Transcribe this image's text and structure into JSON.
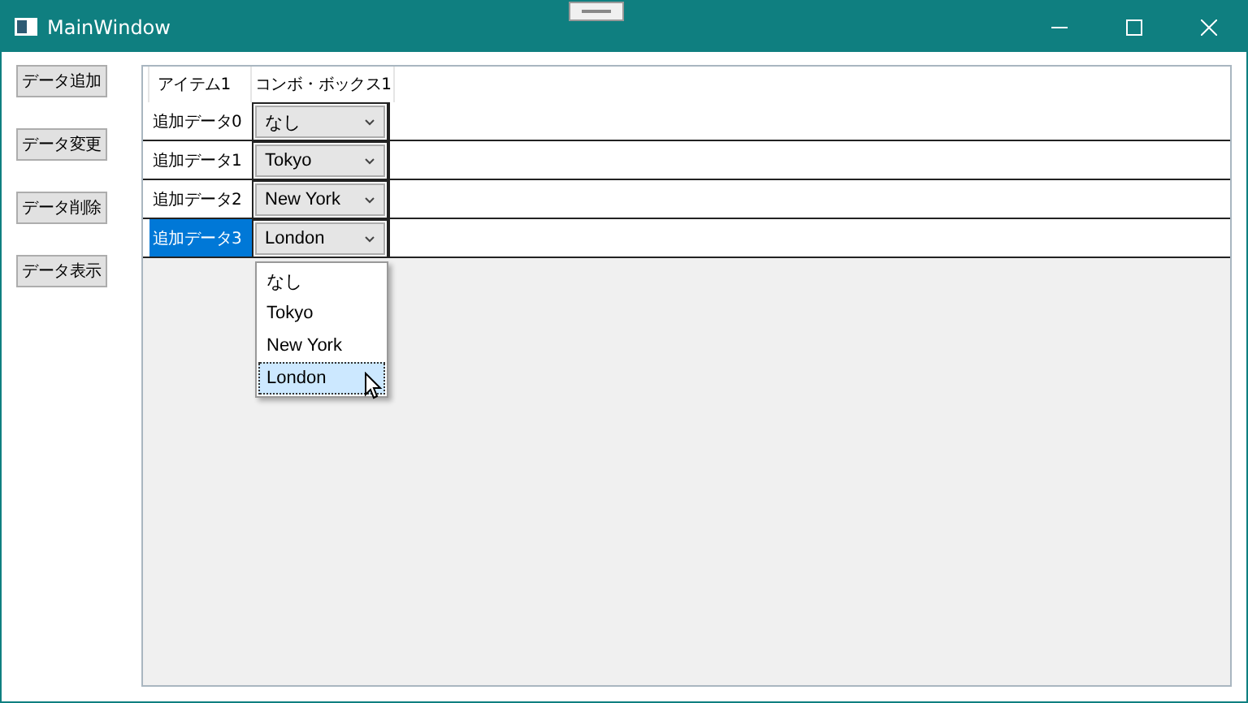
{
  "window": {
    "title": "MainWindow"
  },
  "buttons": [
    "データ追加",
    "データ変更",
    "データ削除",
    "データ表示"
  ],
  "grid": {
    "columns": [
      "アイテム1",
      "コンボ・ボックス1"
    ],
    "rows": [
      {
        "item": "追加データ0",
        "combo": "なし",
        "selected": false
      },
      {
        "item": "追加データ1",
        "combo": "Tokyo",
        "selected": false
      },
      {
        "item": "追加データ2",
        "combo": "New York",
        "selected": false
      },
      {
        "item": "追加データ3",
        "combo": "London",
        "selected": true
      }
    ]
  },
  "dropdown": {
    "options": [
      {
        "label": "なし",
        "selected": false
      },
      {
        "label": "Tokyo",
        "selected": false
      },
      {
        "label": "New York",
        "selected": false
      },
      {
        "label": "London",
        "selected": true
      }
    ]
  }
}
